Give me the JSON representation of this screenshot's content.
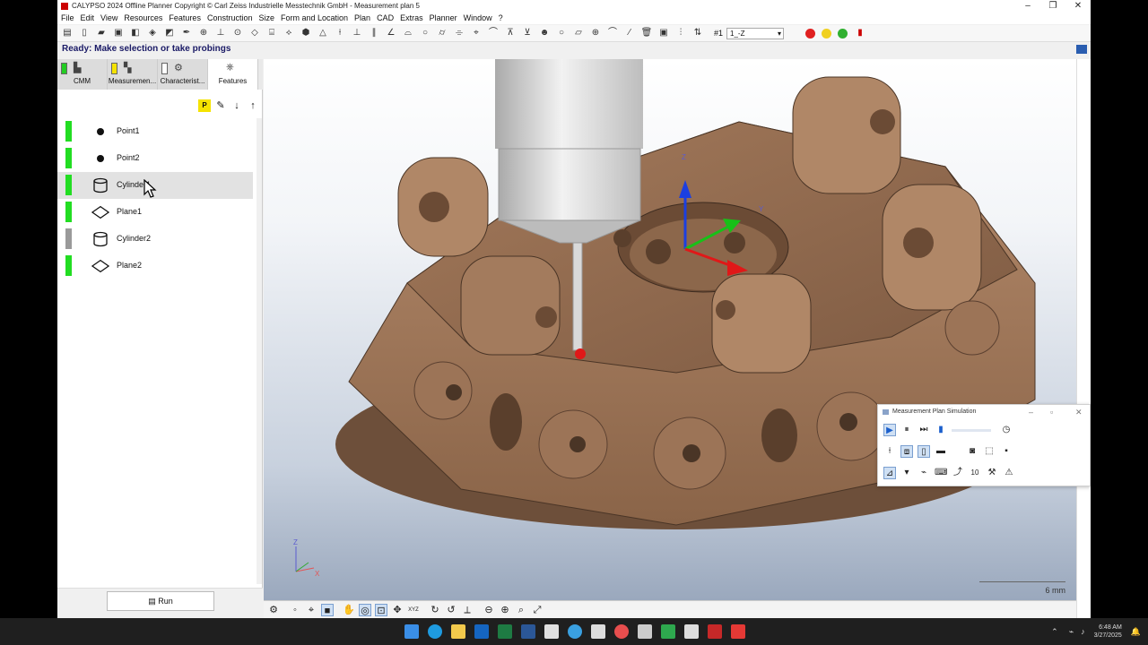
{
  "window": {
    "title": "CALYPSO 2024 Offline Planner Copyright © Carl Zeiss Industrielle Messtechnik GmbH - Measurement plan 5",
    "controls": [
      "–",
      "❐",
      "✕"
    ]
  },
  "menu": [
    "File",
    "Edit",
    "View",
    "Resources",
    "Features",
    "Construction",
    "Size",
    "Form and Location",
    "Plan",
    "CAD",
    "Extras",
    "Planner",
    "Window",
    "?"
  ],
  "toolbar": {
    "selector_label": "#1",
    "selector_value": "1_-Z",
    "status_dots": [
      "#e02020",
      "#f0d020",
      "#30b030"
    ]
  },
  "status": "Ready: Make selection or take probings",
  "tabs": [
    {
      "label": "CMM",
      "indicator": "#22cc22"
    },
    {
      "label": "Measuremen...",
      "indicator": "#f5e300"
    },
    {
      "label": "Characterist...",
      "indicator": "#ffffff"
    },
    {
      "label": "Features",
      "indicator": null
    }
  ],
  "feature_toolbar": {
    "p_label": "P"
  },
  "features": [
    {
      "name": "Point1",
      "type": "point",
      "status": "#22dd22",
      "selected": false
    },
    {
      "name": "Point2",
      "type": "point",
      "status": "#22dd22",
      "selected": false
    },
    {
      "name": "Cylinder1",
      "type": "cylinder",
      "status": "#22dd22",
      "selected": true
    },
    {
      "name": "Plane1",
      "type": "plane",
      "status": "#22dd22",
      "selected": false
    },
    {
      "name": "Cylinder2",
      "type": "cylinder",
      "status": "#9a9a9a",
      "selected": false
    },
    {
      "name": "Plane2",
      "type": "plane",
      "status": "#22dd22",
      "selected": false
    }
  ],
  "run_label": "Run",
  "viewport": {
    "axis_x": "X",
    "axis_y": "Y",
    "axis_z": "Z",
    "triad_x": "X",
    "triad_z": "Z",
    "scale_label": "6 mm",
    "bottom_field": "XYZ"
  },
  "simulation": {
    "title": "Measurement Plan Simulation",
    "speed_value": "10"
  },
  "taskbar": {
    "time": "6:48 AM",
    "date": "3/27/2025"
  }
}
